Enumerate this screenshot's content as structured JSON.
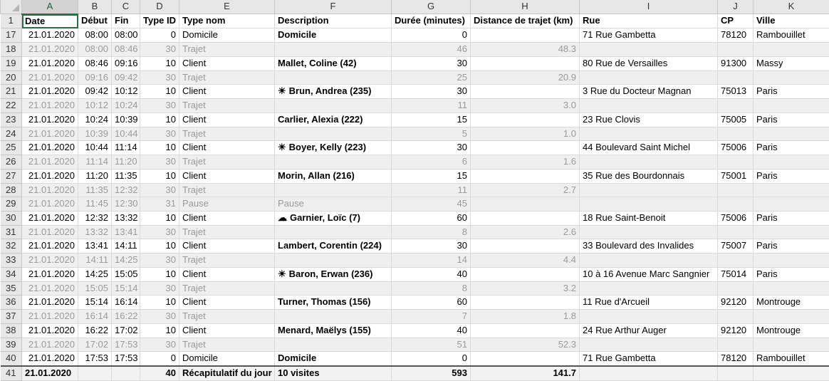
{
  "columns": [
    "A",
    "B",
    "C",
    "D",
    "E",
    "F",
    "G",
    "H",
    "I",
    "J",
    "K"
  ],
  "selected_column": "A",
  "headers": {
    "row_num": "1",
    "date": "Date",
    "debut": "Début",
    "fin": "Fin",
    "type_id": "Type ID",
    "type_nom": "Type nom",
    "description": "Description",
    "duree": "Durée (minutes)",
    "distance": "Distance de trajet (km)",
    "rue": "Rue",
    "cp": "CP",
    "ville": "Ville"
  },
  "icons": {
    "sun": "☀",
    "cloud": "☁"
  },
  "rows": [
    {
      "n": "17",
      "date": "21.01.2020",
      "debut": "08:00",
      "fin": "08:00",
      "type_id": "0",
      "type_nom": "Domicile",
      "desc": "Domicile",
      "icon": "",
      "duree": "0",
      "dist": "",
      "rue": "71 Rue Gambetta",
      "cp": "78120",
      "ville": "Rambouillet",
      "kind": "home"
    },
    {
      "n": "18",
      "date": "21.01.2020",
      "debut": "08:00",
      "fin": "08:46",
      "type_id": "30",
      "type_nom": "Trajet",
      "desc": "",
      "icon": "",
      "duree": "46",
      "dist": "48.3",
      "rue": "",
      "cp": "",
      "ville": "",
      "kind": "travel"
    },
    {
      "n": "19",
      "date": "21.01.2020",
      "debut": "08:46",
      "fin": "09:16",
      "type_id": "10",
      "type_nom": "Client",
      "desc": "Mallet, Coline (42)",
      "icon": "",
      "duree": "30",
      "dist": "",
      "rue": "80 Rue de Versailles",
      "cp": "91300",
      "ville": "Massy",
      "kind": "client"
    },
    {
      "n": "20",
      "date": "21.01.2020",
      "debut": "09:16",
      "fin": "09:42",
      "type_id": "30",
      "type_nom": "Trajet",
      "desc": "",
      "icon": "",
      "duree": "25",
      "dist": "20.9",
      "rue": "",
      "cp": "",
      "ville": "",
      "kind": "travel"
    },
    {
      "n": "21",
      "date": "21.01.2020",
      "debut": "09:42",
      "fin": "10:12",
      "type_id": "10",
      "type_nom": "Client",
      "desc": "Brun, Andrea (235)",
      "icon": "sun",
      "duree": "30",
      "dist": "",
      "rue": "3 Rue du Docteur Magnan",
      "cp": "75013",
      "ville": "Paris",
      "kind": "client"
    },
    {
      "n": "22",
      "date": "21.01.2020",
      "debut": "10:12",
      "fin": "10:24",
      "type_id": "30",
      "type_nom": "Trajet",
      "desc": "",
      "icon": "",
      "duree": "11",
      "dist": "3.0",
      "rue": "",
      "cp": "",
      "ville": "",
      "kind": "travel"
    },
    {
      "n": "23",
      "date": "21.01.2020",
      "debut": "10:24",
      "fin": "10:39",
      "type_id": "10",
      "type_nom": "Client",
      "desc": "Carlier, Alexia (222)",
      "icon": "",
      "duree": "15",
      "dist": "",
      "rue": "23 Rue Clovis",
      "cp": "75005",
      "ville": "Paris",
      "kind": "client"
    },
    {
      "n": "24",
      "date": "21.01.2020",
      "debut": "10:39",
      "fin": "10:44",
      "type_id": "30",
      "type_nom": "Trajet",
      "desc": "",
      "icon": "",
      "duree": "5",
      "dist": "1.0",
      "rue": "",
      "cp": "",
      "ville": "",
      "kind": "travel"
    },
    {
      "n": "25",
      "date": "21.01.2020",
      "debut": "10:44",
      "fin": "11:14",
      "type_id": "10",
      "type_nom": "Client",
      "desc": "Boyer, Kelly (223)",
      "icon": "sun",
      "duree": "30",
      "dist": "",
      "rue": "44 Boulevard Saint Michel",
      "cp": "75006",
      "ville": "Paris",
      "kind": "client"
    },
    {
      "n": "26",
      "date": "21.01.2020",
      "debut": "11:14",
      "fin": "11:20",
      "type_id": "30",
      "type_nom": "Trajet",
      "desc": "",
      "icon": "",
      "duree": "6",
      "dist": "1.6",
      "rue": "",
      "cp": "",
      "ville": "",
      "kind": "travel"
    },
    {
      "n": "27",
      "date": "21.01.2020",
      "debut": "11:20",
      "fin": "11:35",
      "type_id": "10",
      "type_nom": "Client",
      "desc": "Morin, Allan (216)",
      "icon": "",
      "duree": "15",
      "dist": "",
      "rue": "35 Rue des Bourdonnais",
      "cp": "75001",
      "ville": "Paris",
      "kind": "client"
    },
    {
      "n": "28",
      "date": "21.01.2020",
      "debut": "11:35",
      "fin": "12:32",
      "type_id": "30",
      "type_nom": "Trajet",
      "desc": "",
      "icon": "",
      "duree": "11",
      "dist": "2.7",
      "rue": "",
      "cp": "",
      "ville": "",
      "kind": "travel"
    },
    {
      "n": "29",
      "date": "21.01.2020",
      "debut": "11:45",
      "fin": "12:30",
      "type_id": "31",
      "type_nom": "Pause",
      "desc": "Pause",
      "icon": "",
      "duree": "45",
      "dist": "",
      "rue": "",
      "cp": "",
      "ville": "",
      "kind": "pause"
    },
    {
      "n": "30",
      "date": "21.01.2020",
      "debut": "12:32",
      "fin": "13:32",
      "type_id": "10",
      "type_nom": "Client",
      "desc": "Garnier, Loïc (7)",
      "icon": "cloud",
      "duree": "60",
      "dist": "",
      "rue": "18 Rue Saint-Benoit",
      "cp": "75006",
      "ville": "Paris",
      "kind": "client"
    },
    {
      "n": "31",
      "date": "21.01.2020",
      "debut": "13:32",
      "fin": "13:41",
      "type_id": "30",
      "type_nom": "Trajet",
      "desc": "",
      "icon": "",
      "duree": "8",
      "dist": "2.6",
      "rue": "",
      "cp": "",
      "ville": "",
      "kind": "travel"
    },
    {
      "n": "32",
      "date": "21.01.2020",
      "debut": "13:41",
      "fin": "14:11",
      "type_id": "10",
      "type_nom": "Client",
      "desc": "Lambert, Corentin (224)",
      "icon": "",
      "duree": "30",
      "dist": "",
      "rue": "33 Boulevard des Invalides",
      "cp": "75007",
      "ville": "Paris",
      "kind": "client"
    },
    {
      "n": "33",
      "date": "21.01.2020",
      "debut": "14:11",
      "fin": "14:25",
      "type_id": "30",
      "type_nom": "Trajet",
      "desc": "",
      "icon": "",
      "duree": "14",
      "dist": "4.4",
      "rue": "",
      "cp": "",
      "ville": "",
      "kind": "travel"
    },
    {
      "n": "34",
      "date": "21.01.2020",
      "debut": "14:25",
      "fin": "15:05",
      "type_id": "10",
      "type_nom": "Client",
      "desc": "Baron, Erwan (236)",
      "icon": "sun",
      "duree": "40",
      "dist": "",
      "rue": "10 à 16 Avenue Marc Sangnier",
      "cp": "75014",
      "ville": "Paris",
      "kind": "client"
    },
    {
      "n": "35",
      "date": "21.01.2020",
      "debut": "15:05",
      "fin": "15:14",
      "type_id": "30",
      "type_nom": "Trajet",
      "desc": "",
      "icon": "",
      "duree": "8",
      "dist": "3.2",
      "rue": "",
      "cp": "",
      "ville": "",
      "kind": "travel"
    },
    {
      "n": "36",
      "date": "21.01.2020",
      "debut": "15:14",
      "fin": "16:14",
      "type_id": "10",
      "type_nom": "Client",
      "desc": "Turner, Thomas (156)",
      "icon": "",
      "duree": "60",
      "dist": "",
      "rue": "11 Rue d'Arcueil",
      "cp": "92120",
      "ville": "Montrouge",
      "kind": "client"
    },
    {
      "n": "37",
      "date": "21.01.2020",
      "debut": "16:14",
      "fin": "16:22",
      "type_id": "30",
      "type_nom": "Trajet",
      "desc": "",
      "icon": "",
      "duree": "7",
      "dist": "1.8",
      "rue": "",
      "cp": "",
      "ville": "",
      "kind": "travel"
    },
    {
      "n": "38",
      "date": "21.01.2020",
      "debut": "16:22",
      "fin": "17:02",
      "type_id": "10",
      "type_nom": "Client",
      "desc": "Menard, Maëlys (155)",
      "icon": "",
      "duree": "40",
      "dist": "",
      "rue": "24 Rue Arthur Auger",
      "cp": "92120",
      "ville": "Montrouge",
      "kind": "client"
    },
    {
      "n": "39",
      "date": "21.01.2020",
      "debut": "17:02",
      "fin": "17:53",
      "type_id": "30",
      "type_nom": "Trajet",
      "desc": "",
      "icon": "",
      "duree": "51",
      "dist": "52.3",
      "rue": "",
      "cp": "",
      "ville": "",
      "kind": "travel"
    },
    {
      "n": "40",
      "date": "21.01.2020",
      "debut": "17:53",
      "fin": "17:53",
      "type_id": "0",
      "type_nom": "Domicile",
      "desc": "Domicile",
      "icon": "",
      "duree": "0",
      "dist": "",
      "rue": "71 Rue Gambetta",
      "cp": "78120",
      "ville": "Rambouillet",
      "kind": "home"
    }
  ],
  "total": {
    "n": "41",
    "date": "21.01.2020",
    "type_id": "40",
    "type_nom": "Récapitulatif du jour",
    "desc": "10 visites",
    "duree": "593",
    "dist": "141.7"
  }
}
